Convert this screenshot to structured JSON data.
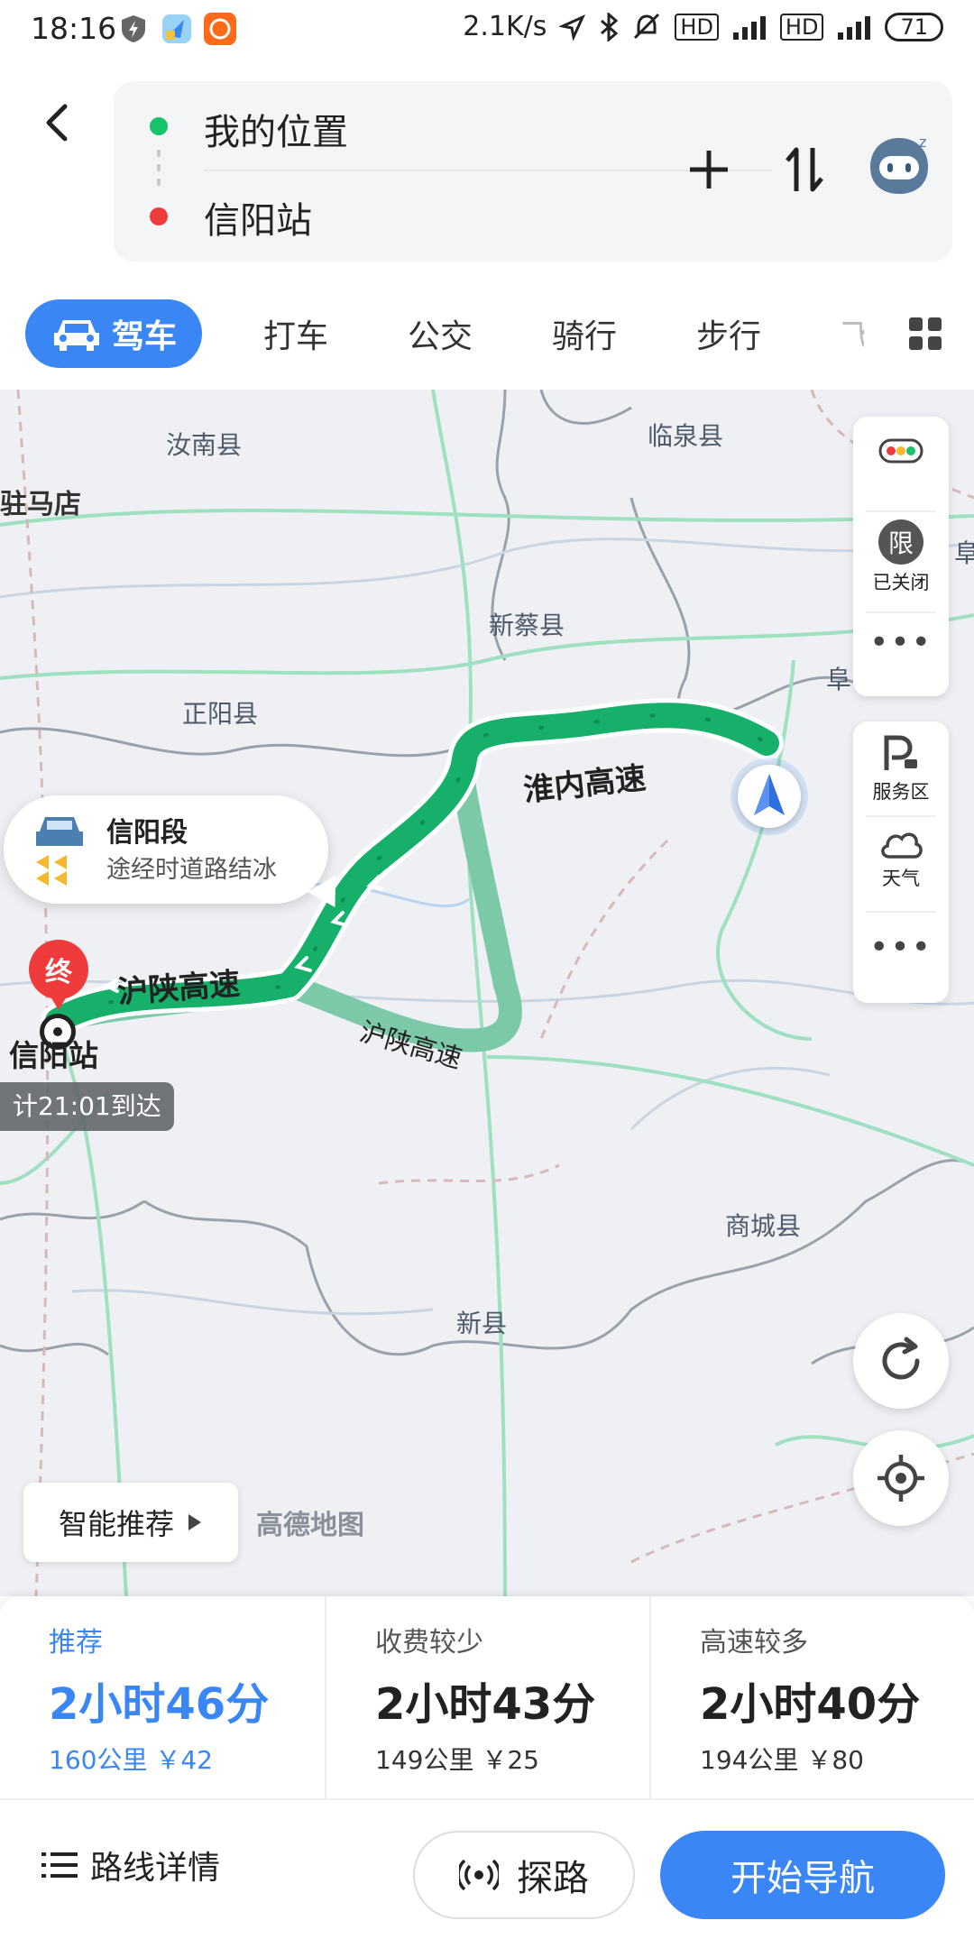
{
  "status_bar": {
    "time": "18:16",
    "network_speed": "2.1K/s",
    "hd1": "HD",
    "hd2": "HD",
    "battery": "71"
  },
  "route_input": {
    "origin": "我的位置",
    "destination": "信阳站"
  },
  "tabs": {
    "active": "驾车",
    "items": [
      "打车",
      "公交",
      "骑行",
      "步行",
      "飞"
    ]
  },
  "map": {
    "places": {
      "p1": "汝南县",
      "p2": "临泉县",
      "p3": "驻马店",
      "p4": "新蔡县",
      "p5": "正阳县",
      "p6": "阜",
      "p7": "阜",
      "p8": "商城县",
      "p9": "新县"
    },
    "highway_labels": {
      "h1": "淮内高速",
      "h2": "沪陕高速",
      "h3": "沪陕高速"
    },
    "callout": {
      "title": "信阳段",
      "subtitle": "途经时道路结冰"
    },
    "end_marker": "终",
    "destination_label": "信阳站",
    "eta": "计21:01到达",
    "side_panel": {
      "limit_icon": "限",
      "limit_label": "已关闭",
      "service_label": "服务区",
      "weather_label": "天气"
    },
    "smart_recommend": "智能推荐",
    "watermark": "高德地图"
  },
  "routes": [
    {
      "tag": "推荐",
      "time": "2小时46分",
      "meta": "160公里 ￥42"
    },
    {
      "tag": "收费较少",
      "time": "2小时43分",
      "meta": "149公里 ￥25"
    },
    {
      "tag": "高速较多",
      "time": "2小时40分",
      "meta": "194公里 ￥80"
    }
  ],
  "bottom": {
    "details": "路线详情",
    "explore": "探路",
    "start": "开始导航"
  },
  "colors": {
    "accent": "#3a86f4",
    "route_main": "#16b06a",
    "route_alt": "#7cc9a8"
  }
}
